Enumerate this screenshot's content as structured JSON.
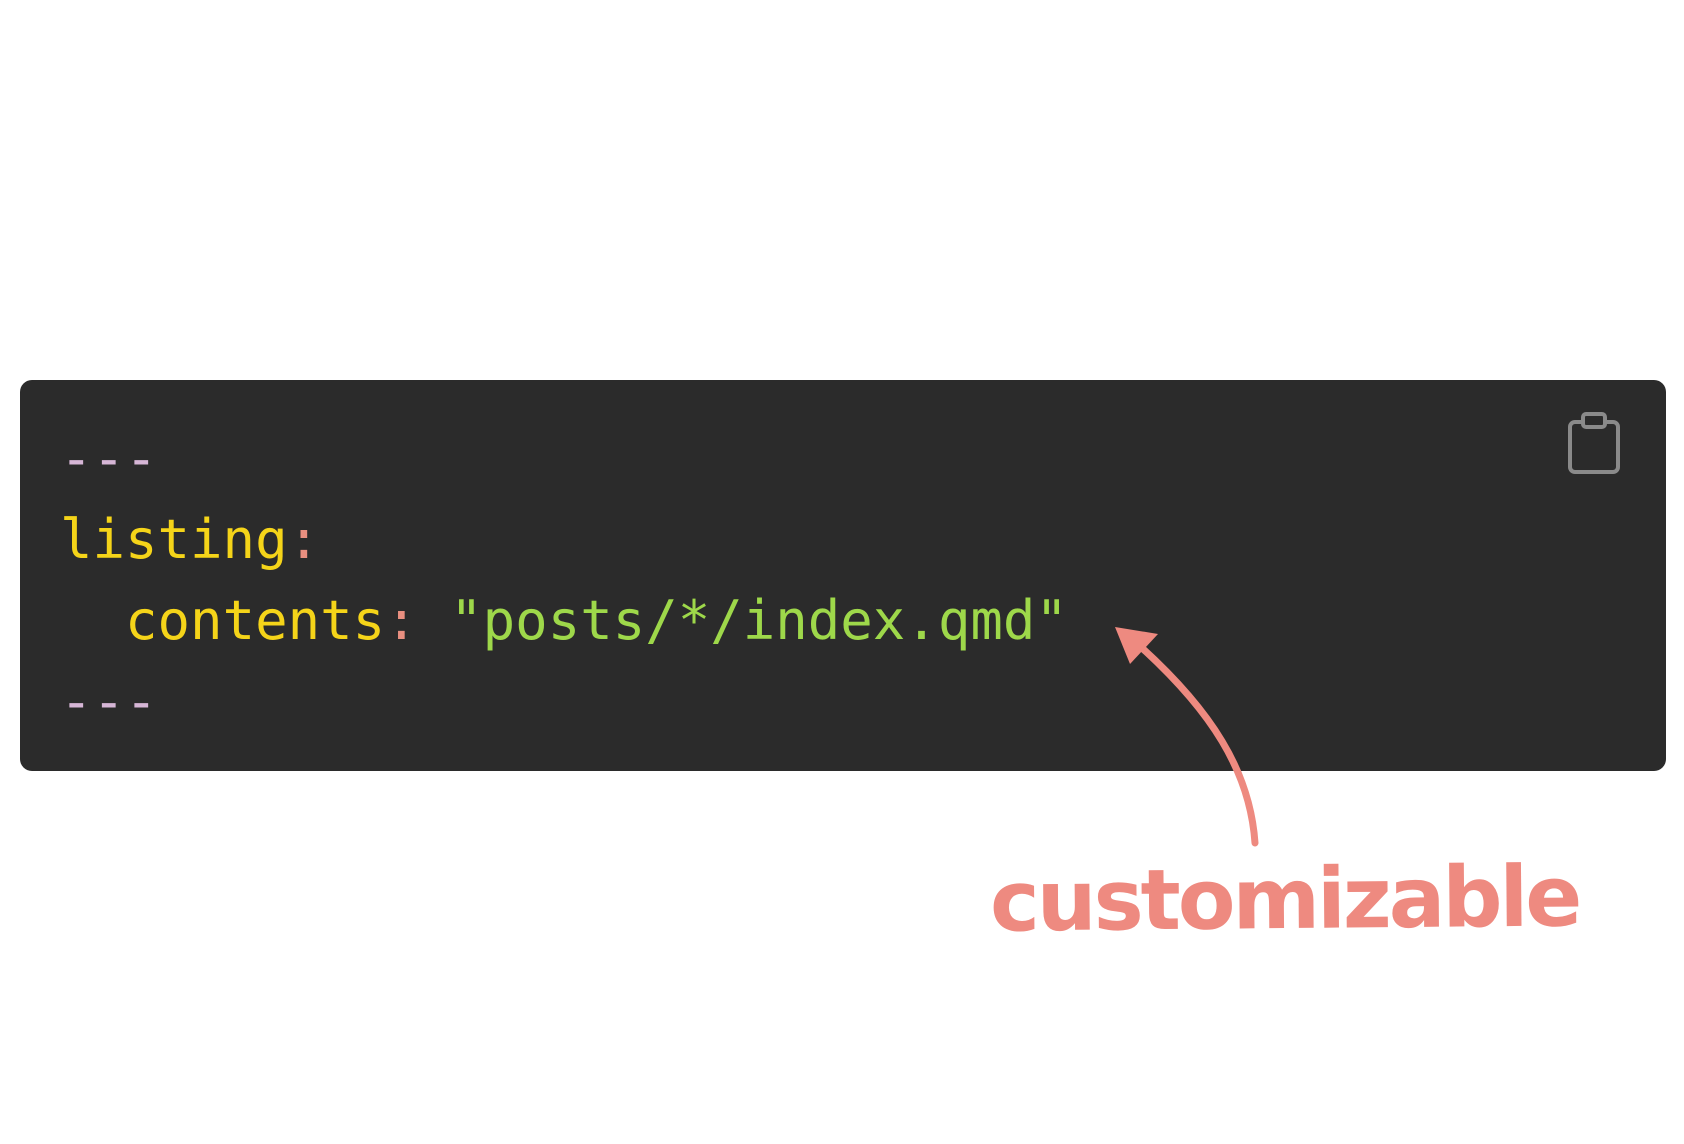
{
  "code": {
    "lines": {
      "0": {
        "delim": "---"
      },
      "1": {
        "key": "listing",
        "colon": ":"
      },
      "2": {
        "indent": "  ",
        "key": "contents",
        "colon": ":",
        "space": " ",
        "value": "\"posts/*/index.qmd\""
      },
      "3": {
        "delim": "---"
      }
    }
  },
  "copy_button": {
    "icon": "clipboard-icon"
  },
  "annotation": {
    "text": "customizable",
    "color": "#ee8a80",
    "arrow_icon": "curved-arrow-icon"
  },
  "colors": {
    "background": "#ffffff",
    "code_background": "#2b2b2b",
    "delimiter": "#d6b6d6",
    "key": "#f5d419",
    "colon": "#e98f80",
    "string": "#9ed84a",
    "icon": "#8a8a8a"
  }
}
